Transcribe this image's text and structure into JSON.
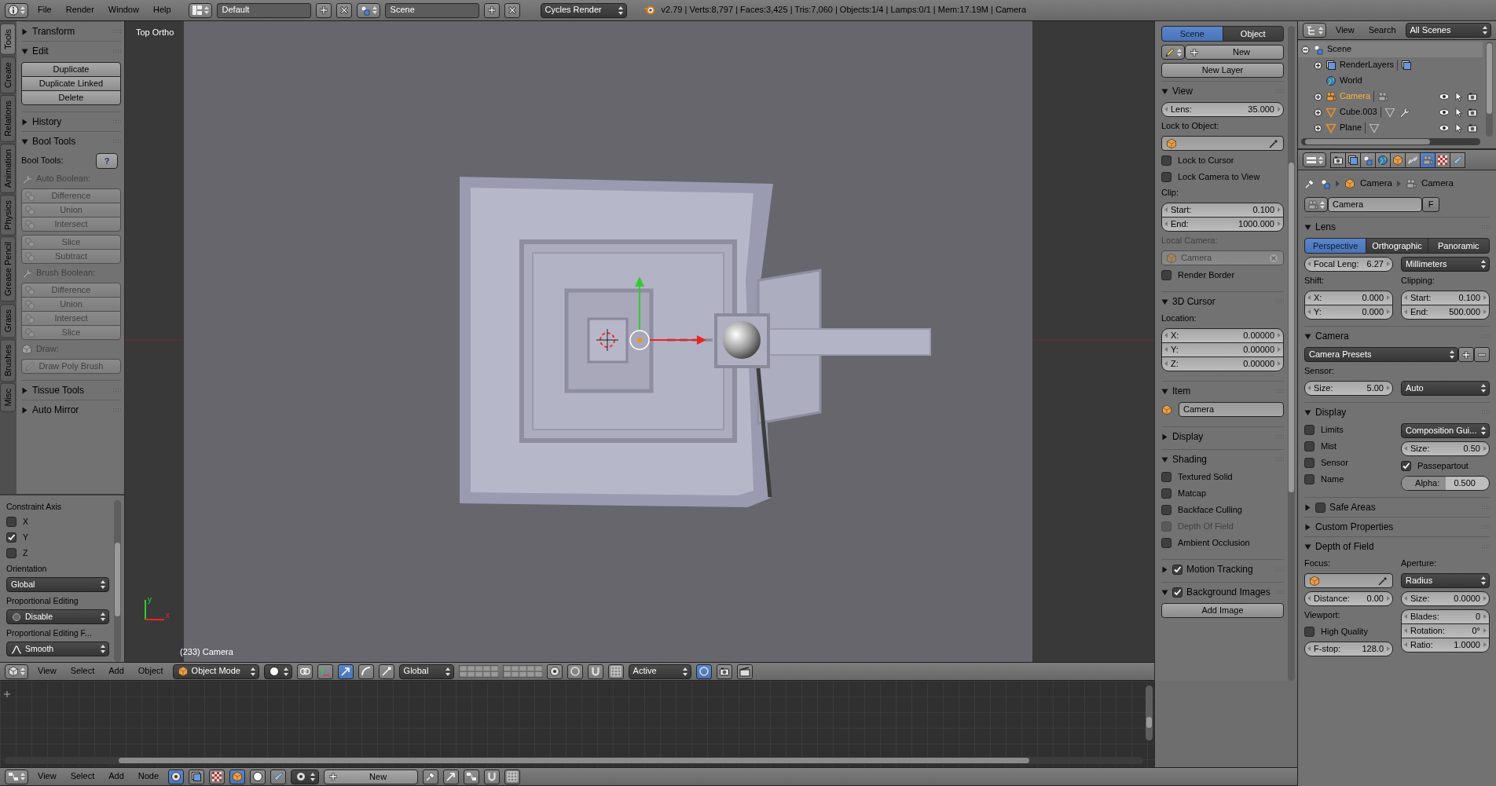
{
  "top_bar": {
    "menus": [
      "File",
      "Render",
      "Window",
      "Help"
    ],
    "layout": "Default",
    "scene": "Scene",
    "engine": "Cycles Render",
    "stats": "v2.79 | Verts:8,797 | Faces:3,425 | Tris:7,060 | Objects:1/4 | Lamps:0/1 | Mem:17.19M | Camera"
  },
  "tool_tabs": [
    {
      "label": "Tools",
      "selected": true
    },
    {
      "label": "Create",
      "selected": false
    },
    {
      "label": "Relations",
      "selected": false
    },
    {
      "label": "Animation",
      "selected": false
    },
    {
      "label": "Physics",
      "selected": false
    },
    {
      "label": "Grease Pencil",
      "selected": false
    },
    {
      "label": "Grass",
      "selected": false
    },
    {
      "label": "Brushes",
      "selected": false
    },
    {
      "label": "Misc",
      "selected": false
    }
  ],
  "tool_shelf": {
    "panels": [
      {
        "title": "Transform",
        "expanded": false
      },
      {
        "title": "Edit",
        "expanded": true,
        "rows": [
          {
            "kind": "buttons",
            "items": [
              "Duplicate",
              "Duplicate Linked",
              "Delete"
            ],
            "disabled": false
          }
        ]
      },
      {
        "title": "History",
        "expanded": false
      },
      {
        "title": "Bool Tools",
        "expanded": true,
        "rows": [
          {
            "kind": "help",
            "label": "Bool Tools:",
            "button": "?"
          },
          {
            "kind": "toollabel",
            "text": "Auto Boolean:",
            "disabled": true
          },
          {
            "kind": "iconbuttons",
            "items": [
              "Difference",
              "Union",
              "Intersect"
            ],
            "disabled": true
          },
          {
            "kind": "iconbuttons",
            "items": [
              "Slice",
              "Subtract"
            ],
            "disabled": true
          },
          {
            "kind": "toollabel",
            "text": "Brush Boolean:",
            "disabled": true
          },
          {
            "kind": "iconbuttons",
            "items": [
              "Difference",
              "Union",
              "Intersect",
              "Slice"
            ],
            "disabled": true
          },
          {
            "kind": "objectlabel",
            "text": "Draw:",
            "disabled": true
          },
          {
            "kind": "penbuttons",
            "items": [
              "Draw Poly Brush"
            ],
            "disabled": true
          }
        ]
      },
      {
        "title": "Tissue Tools",
        "expanded": false
      },
      {
        "title": "Auto Mirror",
        "expanded": false
      }
    ]
  },
  "redo_panel": {
    "rows": [
      {
        "kind": "label",
        "text": "Constraint Axis"
      },
      {
        "kind": "check",
        "label": "X",
        "checked": false
      },
      {
        "kind": "check",
        "label": "Y",
        "checked": true
      },
      {
        "kind": "check",
        "label": "Z",
        "checked": false
      },
      {
        "kind": "label",
        "text": "Orientation"
      },
      {
        "kind": "select",
        "value": "Global"
      },
      {
        "kind": "label",
        "text": "Proportional Editing"
      },
      {
        "kind": "radioselect",
        "value": "Disable"
      },
      {
        "kind": "label",
        "text": "Proportional Editing F..."
      },
      {
        "kind": "curveselect",
        "value": "Smooth"
      }
    ]
  },
  "viewport": {
    "view_name": "Top Ortho",
    "info": "(233) Camera",
    "axis_y": "y",
    "axis_x": "x"
  },
  "viewport_header": {
    "menus": [
      "View",
      "Select",
      "Add",
      "Object"
    ],
    "mode": "Object Mode",
    "orientation": "Global",
    "snap_target": "Active"
  },
  "n_panel": {
    "rows": [
      {
        "kind": "toggle",
        "items": [
          {
            "label": "Scene",
            "selected": true
          },
          {
            "label": "Object",
            "selected": false
          }
        ]
      },
      {
        "kind": "datablock",
        "button": "New"
      },
      {
        "kind": "button",
        "label": "New Layer"
      }
    ],
    "panels": [
      {
        "title": "View",
        "expanded": true,
        "rows": [
          {
            "kind": "numbers",
            "items": [
              {
                "label": "Lens:",
                "value": "35.000"
              }
            ]
          },
          {
            "kind": "label",
            "text": "Lock to Object:"
          },
          {
            "kind": "picker"
          },
          {
            "kind": "check",
            "label": "Lock to Cursor",
            "checked": false
          },
          {
            "kind": "check",
            "label": "Lock Camera to View",
            "checked": false
          },
          {
            "kind": "label",
            "text": "Clip:"
          },
          {
            "kind": "numbers",
            "items": [
              {
                "label": "Start:",
                "value": "0.100"
              },
              {
                "label": "End:",
                "value": "1000.000"
              }
            ]
          },
          {
            "kind": "label",
            "text": "Local Camera:",
            "disabled": true
          },
          {
            "kind": "clearfield",
            "value": "Camera",
            "disabled": true
          },
          {
            "kind": "check",
            "label": "Render Border",
            "checked": false
          }
        ]
      },
      {
        "title": "3D Cursor",
        "expanded": true,
        "rows": [
          {
            "kind": "label",
            "text": "Location:"
          },
          {
            "kind": "numbers",
            "items": [
              {
                "label": "X:",
                "value": "0.00000"
              },
              {
                "label": "Y:",
                "value": "0.00000"
              },
              {
                "label": "Z:",
                "value": "0.00000"
              }
            ]
          }
        ]
      },
      {
        "title": "Item",
        "expanded": true,
        "rows": [
          {
            "kind": "objectfield",
            "value": "Camera"
          }
        ]
      },
      {
        "title": "Display",
        "expanded": false
      },
      {
        "title": "Shading",
        "expanded": true,
        "rows": [
          {
            "kind": "check",
            "label": "Textured Solid",
            "checked": false
          },
          {
            "kind": "check",
            "label": "Matcap",
            "checked": false
          },
          {
            "kind": "check",
            "label": "Backface Culling",
            "checked": false
          },
          {
            "kind": "check",
            "label": "Depth Of Field",
            "checked": false,
            "disabled": true
          },
          {
            "kind": "check",
            "label": "Ambient Occlusion",
            "checked": false
          }
        ]
      },
      {
        "title": "Motion Tracking",
        "expanded": false,
        "checked": true
      },
      {
        "title": "Background Images",
        "expanded": true,
        "checked": true,
        "rows": [
          {
            "kind": "button",
            "label": "Add Image"
          }
        ]
      }
    ]
  },
  "outliner": {
    "menus": [
      "View",
      "Search"
    ],
    "filter": "All Scenes",
    "tree": [
      {
        "label": "Scene",
        "kind": "scene",
        "selected": false,
        "expanded": true,
        "children": [
          {
            "label": "RenderLayers",
            "kind": "renderlayers",
            "selected": false,
            "expanded": false
          },
          {
            "label": "World",
            "kind": "world",
            "selected": false
          },
          {
            "label": "Camera",
            "kind": "camera",
            "selected": true,
            "expanded": false
          },
          {
            "label": "Cube.003",
            "kind": "mesh",
            "selected": false,
            "expanded": false,
            "modifiers": true
          },
          {
            "label": "Plane",
            "kind": "mesh",
            "selected": false,
            "expanded": false,
            "modifiers": false
          }
        ]
      }
    ]
  },
  "properties": {
    "context_tabs": [
      {
        "selected": false
      },
      {
        "selected": false
      },
      {
        "selected": false
      },
      {
        "selected": false
      },
      {
        "selected": false
      },
      {
        "selected": false
      },
      {
        "selected": true
      },
      {
        "selected": false
      },
      {
        "selected": false
      }
    ],
    "breadcrumb": [
      "Camera",
      "Camera"
    ],
    "datablock": {
      "name": "Camera",
      "fake_user": "F"
    },
    "panels": [
      {
        "title": "Lens",
        "expanded": true,
        "rows": [
          {
            "kind": "toggle",
            "items": [
              {
                "label": "Perspective",
                "selected": true
              },
              {
                "label": "Orthographic",
                "selected": false
              },
              {
                "label": "Panoramic",
                "selected": false
              }
            ]
          },
          {
            "kind": "columns",
            "left": [
              {
                "kind": "numbers",
                "items": [
                  {
                    "label": "Focal Leng:",
                    "value": "6.27"
                  }
                ]
              }
            ],
            "right": [
              {
                "kind": "select",
                "value": "Millimeters"
              }
            ]
          },
          {
            "kind": "columns",
            "left": [
              {
                "kind": "label",
                "text": "Shift:"
              },
              {
                "kind": "numbers",
                "items": [
                  {
                    "label": "X:",
                    "value": "0.000"
                  },
                  {
                    "label": "Y:",
                    "value": "0.000"
                  }
                ]
              }
            ],
            "right": [
              {
                "kind": "label",
                "text": "Clipping:"
              },
              {
                "kind": "numbers",
                "items": [
                  {
                    "label": "Start:",
                    "value": "0.100"
                  },
                  {
                    "label": "End:",
                    "value": "500.000"
                  }
                ]
              }
            ]
          }
        ]
      },
      {
        "title": "Camera",
        "expanded": true,
        "rows": [
          {
            "kind": "presets",
            "value": "Camera Presets"
          },
          {
            "kind": "label",
            "text": "Sensor:"
          },
          {
            "kind": "columns",
            "left": [
              {
                "kind": "numbers",
                "items": [
                  {
                    "label": "Size:",
                    "value": "5.00"
                  }
                ]
              }
            ],
            "right": [
              {
                "kind": "select",
                "value": "Auto"
              }
            ]
          }
        ]
      },
      {
        "title": "Display",
        "expanded": true,
        "rows": [
          {
            "kind": "columns",
            "left": [
              {
                "kind": "check",
                "label": "Limits",
                "checked": false
              },
              {
                "kind": "check",
                "label": "Mist",
                "checked": false
              },
              {
                "kind": "check",
                "label": "Sensor",
                "checked": false
              },
              {
                "kind": "check",
                "label": "Name",
                "checked": false
              }
            ],
            "right": [
              {
                "kind": "select",
                "value": "Composition Gui..."
              },
              {
                "kind": "numbers",
                "items": [
                  {
                    "label": "Size:",
                    "value": "0.50"
                  }
                ]
              },
              {
                "kind": "check",
                "label": "Passepartout",
                "checked": true
              },
              {
                "kind": "slider",
                "label": "Alpha:",
                "value": "0.500",
                "level": 0.5
              }
            ]
          }
        ]
      },
      {
        "title": "Safe Areas",
        "expanded": false,
        "checked": false
      },
      {
        "title": "Custom Properties",
        "expanded": false
      },
      {
        "title": "Depth of Field",
        "expanded": true,
        "rows": [
          {
            "kind": "columns",
            "left": [
              {
                "kind": "label",
                "text": "Focus:"
              },
              {
                "kind": "picker"
              },
              {
                "kind": "numbers",
                "items": [
                  {
                    "label": "Distance:",
                    "value": "0.00"
                  }
                ]
              },
              {
                "kind": "label",
                "text": "Viewport:"
              },
              {
                "kind": "check",
                "label": "High Quality",
                "checked": false
              },
              {
                "kind": "numbers",
                "items": [
                  {
                    "label": "F-stop:",
                    "value": "128.0"
                  }
                ]
              }
            ],
            "right": [
              {
                "kind": "label",
                "text": "Aperture:"
              },
              {
                "kind": "select",
                "value": "Radius"
              },
              {
                "kind": "numbers",
                "items": [
                  {
                    "label": "Size:",
                    "value": "0.0000"
                  }
                ]
              },
              {
                "kind": "numbers",
                "items": [
                  {
                    "label": "Blades:",
                    "value": "0"
                  },
                  {
                    "label": "Rotation:",
                    "value": "0°"
                  },
                  {
                    "label": "Ratio:",
                    "value": "1.0000"
                  }
                ]
              }
            ]
          }
        ]
      }
    ]
  },
  "node_header": {
    "menus": [
      "View",
      "Select",
      "Add",
      "Node"
    ],
    "new_button": "New"
  }
}
